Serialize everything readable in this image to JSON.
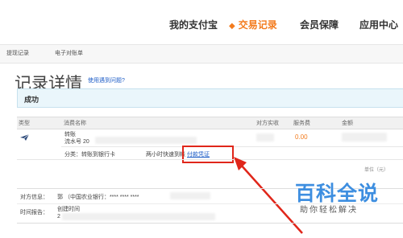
{
  "nav": {
    "items": [
      {
        "label": "我的支付宝",
        "active": false
      },
      {
        "label": "交易记录",
        "active": true
      },
      {
        "label": "会员保障",
        "active": false
      },
      {
        "label": "应用中心",
        "active": false
      }
    ]
  },
  "subtabs": [
    "提现记录",
    "电子对账单"
  ],
  "page": {
    "title": "记录详情",
    "help_link": "使用遇到问题?"
  },
  "status": "成功",
  "table": {
    "headers": [
      "类型",
      "消费名称",
      "对方实收",
      "服务费",
      "金额"
    ],
    "row": {
      "name": "转账",
      "serial_prefix": "流水号 20",
      "service_fee": "0.00",
      "category": "分类：转账到银行卡",
      "arrival": "两小时快速到帐",
      "evidence_link": "付款凭证"
    },
    "unit_note": "单位（元）"
  },
  "info": {
    "counterparty_label": "对方信息：",
    "counterparty_value": "郭 （中国农业银行：**** **** ****",
    "time_label": "时间报告：",
    "created_label": "创建时间",
    "created_value": "2"
  },
  "watermark": {
    "title": "百科全说",
    "subtitle": "助你轻松解决"
  },
  "colors": {
    "accent": "#f37b1d",
    "link": "#1f5ec7",
    "highlight_box": "#e0261a",
    "watermark": "#3d8ee0"
  }
}
